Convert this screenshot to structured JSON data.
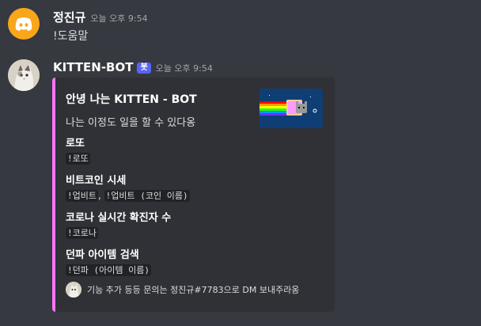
{
  "messages": [
    {
      "author": "정진규",
      "timestamp": "오늘 오후 9:54",
      "text": "!도움말",
      "avatar_icon": "discord-logo-icon",
      "avatar_color": "#faa61a"
    },
    {
      "author": "KITTEN-BOT",
      "bot_tag": "봇",
      "timestamp": "오늘 오후 9:54",
      "avatar_icon": "cat-photo-avatar",
      "embed": {
        "accent_color": "#ff73fa",
        "title": "안녕 나는 KITTEN - BOT",
        "description": "나는 이정도 일을 할 수 있다옹",
        "thumbnail_icon": "nyan-cat-icon",
        "fields": [
          {
            "name": "로또",
            "commands": [
              "!로또"
            ]
          },
          {
            "name": "비트코인 시세",
            "commands": [
              "!업비트",
              "!업비트 (코인 이름)"
            ],
            "separator": ", "
          },
          {
            "name": "코로나 실시간 확진자 수",
            "commands": [
              "!코로나"
            ]
          },
          {
            "name": "던파 아이템 검색",
            "commands": [
              "!던파 (아이템 이름)"
            ]
          }
        ],
        "footer": {
          "text": "기능 추가 등등 문의는 정진규#7783으로 DM 보내주라옹",
          "icon": "cat-photo-avatar"
        }
      }
    }
  ]
}
